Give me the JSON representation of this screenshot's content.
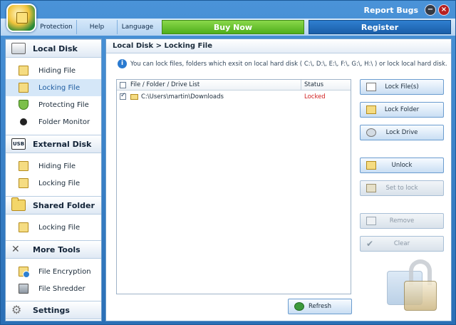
{
  "header": {
    "report_bugs": "Report Bugs",
    "minimize_symbol": "−",
    "close_symbol": "×"
  },
  "menu": {
    "items": [
      "Protection",
      "Help",
      "Language"
    ],
    "buy_now": "Buy Now",
    "register": "Register"
  },
  "sidebar": {
    "sections": [
      {
        "title": "Local Disk",
        "icon": "hard-disk-icon",
        "items": [
          {
            "label": "Hiding File",
            "icon": "hide-file-icon"
          },
          {
            "label": "Locking File",
            "icon": "lock-file-icon",
            "active": true
          },
          {
            "label": "Protecting File",
            "icon": "shield-icon"
          },
          {
            "label": "Folder Monitor",
            "icon": "monitor-dot-icon"
          }
        ]
      },
      {
        "title": "External Disk",
        "icon": "usb-icon",
        "icon_text": "USB",
        "items": [
          {
            "label": "Hiding File",
            "icon": "hide-file-icon"
          },
          {
            "label": "Locking File",
            "icon": "lock-file-icon"
          }
        ]
      },
      {
        "title": "Shared Folder",
        "icon": "shared-folder-icon",
        "items": [
          {
            "label": "Locking File",
            "icon": "lock-file-icon"
          }
        ]
      },
      {
        "title": "More Tools",
        "icon": "tools-icon",
        "items": [
          {
            "label": "File Encryption",
            "icon": "encryption-icon"
          },
          {
            "label": "File Shredder",
            "icon": "shredder-icon"
          }
        ]
      },
      {
        "title": "Settings",
        "icon": "gear-icon",
        "items": []
      }
    ]
  },
  "main": {
    "breadcrumb": "Local Disk > Locking File",
    "info_text": "You can lock files, folders which exsit on local hard disk ( C:\\, D:\\, E:\\, F:\\, G:\\, H:\\ ) or lock local hard disk.",
    "table": {
      "col_path": "File / Folder / Drive List",
      "col_status": "Status",
      "rows": [
        {
          "checked": true,
          "path": "C:\\Users\\martin\\Downloads",
          "status": "Locked"
        }
      ]
    },
    "buttons": {
      "lock_files": "Lock File(s)",
      "lock_folder": "Lock Folder",
      "lock_drive": "Lock Drive",
      "unlock": "Unlock",
      "set_to_lock": "Set to lock",
      "remove": "Remove",
      "clear": "Clear",
      "refresh": "Refresh"
    }
  }
}
